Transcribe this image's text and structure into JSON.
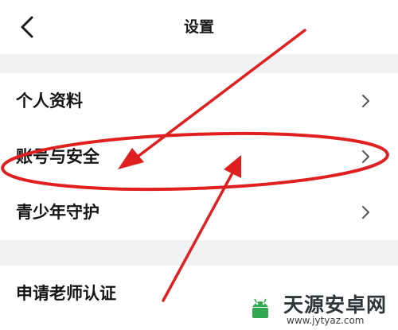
{
  "header": {
    "title": "设置",
    "back_icon": "chevron-left-icon"
  },
  "settings": {
    "items": [
      {
        "label": "个人资料",
        "icon": "chevron-right-icon"
      },
      {
        "label": "账号与安全",
        "icon": "chevron-right-icon"
      },
      {
        "label": "青少年守护",
        "icon": "chevron-right-icon"
      },
      {
        "label": "申请老师认证"
      }
    ]
  },
  "annotation": {
    "color": "#e02020"
  },
  "watermark": {
    "name": "天源安卓网",
    "url": "www.jytyaz.com"
  }
}
